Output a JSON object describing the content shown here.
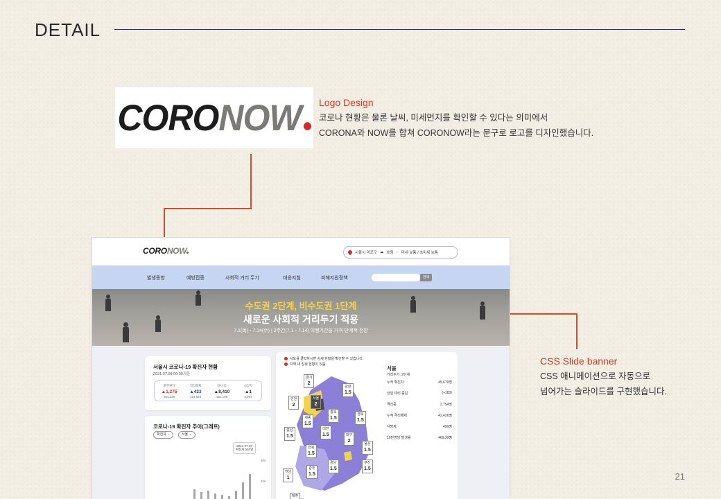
{
  "slide": {
    "title": "DETAIL",
    "page_number": "21"
  },
  "logo": {
    "part1": "CORO",
    "part2": "NOW",
    "dot_color": "#d62b22"
  },
  "annotations": {
    "logo": {
      "heading": "Logo Design",
      "line1": "코로나 현황은 물론 날씨, 미세먼지를 확인할 수 있다는 의미에서",
      "line2": "CORONA와 NOW를 합쳐 CORONOW라는 문구로 로고를 디자인했습니다."
    },
    "banner": {
      "heading": "CSS Slide banner",
      "line1": "CSS 애니메이션으로 자동으로",
      "line2": "넘어가는 슬라이드를 구현했습니다."
    }
  },
  "mockup": {
    "status": {
      "location": "서울시 마포구",
      "weather": "흐림",
      "dust": "미세 보통 / 초미세 보통"
    },
    "nav": [
      "발생동향",
      "예방접종",
      "사회적 거리 두기",
      "대응지침",
      "피해지원정책"
    ],
    "search_button": "검색",
    "banner": {
      "line1": "수도권 2단계, 비수도권 1단계",
      "line2": "새로운 사회적 거리두기 적용",
      "line3": "7.1(목) - 7.14(수) | 2주간(7.1 - 7.14) 이행기간을 거쳐 단계적 전환"
    },
    "status_card": {
      "title": "서울시 코로나-19 확진자 현황",
      "date": "2021.07.08 00:00기준",
      "stats": [
        {
          "label": "확진환자",
          "value": "▲1,275",
          "total": "164,028",
          "color": "#d62b22"
        },
        {
          "label": "격리해제",
          "value": "▲423",
          "total": "151,923",
          "color": "#2a3fb8"
        },
        {
          "label": "검사 중",
          "value": "▲8,410",
          "total": "151,158",
          "color": "#333333"
        },
        {
          "label": "사망자",
          "value": "▲1",
          "total": "2,034",
          "color": "#333333"
        }
      ]
    },
    "trend_card": {
      "title": "코로나-19 확진자 추이(그래프)",
      "select1": "확진자",
      "select2": "서울",
      "tooltip_date": "2021-07-07",
      "tooltip_value": "확진자 550명",
      "y_ticks": [
        "600",
        "400"
      ]
    },
    "map_card": {
      "note1": "시도를 클릭하시면 상세 현황을 확인할 수 있습니다.",
      "note2": "지역 내 상세 현황이 있음",
      "regions": [
        {
          "name": "경기",
          "level": "2"
        },
        {
          "name": "강원",
          "level": "1.5"
        },
        {
          "name": "인천",
          "level": "2"
        },
        {
          "name": "서울",
          "level": "2"
        },
        {
          "name": "세종",
          "level": "1.5"
        },
        {
          "name": "충북",
          "level": "1.5"
        },
        {
          "name": "경북",
          "level": "1.5"
        },
        {
          "name": "충남",
          "level": "1.5"
        },
        {
          "name": "대전",
          "level": "1.5"
        },
        {
          "name": "대구",
          "level": "2"
        },
        {
          "name": "전북",
          "level": "1.5"
        },
        {
          "name": "울산",
          "level": "1.5"
        },
        {
          "name": "경남",
          "level": "1.5"
        },
        {
          "name": "부산",
          "level": "1.5"
        },
        {
          "name": "광주",
          "level": "1.5"
        },
        {
          "name": "전남",
          "level": "1"
        },
        {
          "name": "제주",
          "level": ""
        }
      ],
      "detail": {
        "city": "서울",
        "stage": "거리두기: 2단계",
        "rows": [
          {
            "label": "누적 확진자",
            "value": "45,679명"
          },
          {
            "label": "전일 대비 증감",
            "value": "(+183)"
          },
          {
            "label": "격리중",
            "value": "2,754명"
          },
          {
            "label": "누적 격리해제",
            "value": "42,426명"
          },
          {
            "label": "사망자",
            "value": "499명"
          },
          {
            "label": "10만명당 발생률",
            "value": "469.30명"
          }
        ]
      }
    }
  }
}
